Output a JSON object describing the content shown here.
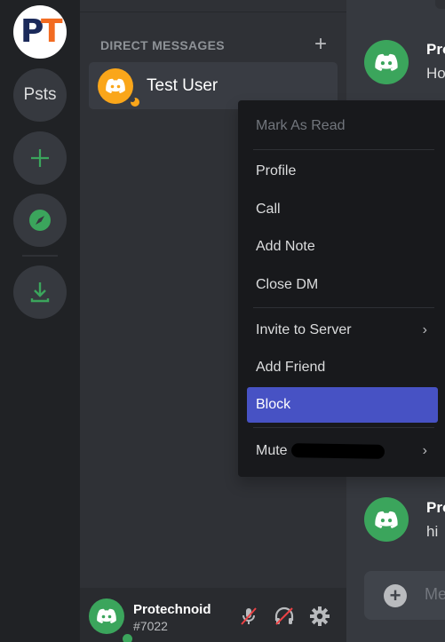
{
  "server_rail": {
    "logo_letters": [
      "P",
      "T"
    ],
    "items": [
      {
        "label": "Psts",
        "type": "server"
      },
      {
        "icon": "plus-icon",
        "label": "Add a Server"
      },
      {
        "icon": "compass-icon",
        "label": "Explore Public Servers"
      },
      {
        "icon": "download-icon",
        "label": "Download Apps"
      }
    ]
  },
  "sidebar": {
    "dm_header": "DIRECT MESSAGES",
    "dm_add_icon": "+",
    "dms": [
      {
        "name": "Test User",
        "avatar_color": "#faa61a",
        "status": "idle"
      }
    ]
  },
  "user_panel": {
    "username": "Protechnoid",
    "discriminator": "#7022",
    "status": "online",
    "mic_muted": true,
    "deafened": true
  },
  "chat": {
    "messages": [
      {
        "author": "Protechnoid",
        "text": "Ho"
      },
      {
        "author": "Protechnoid",
        "text": "hi"
      }
    ],
    "input_placeholder": "Message"
  },
  "context_menu": {
    "items": [
      {
        "label": "Mark As Read",
        "disabled": true
      },
      {
        "label": "Profile"
      },
      {
        "label": "Call"
      },
      {
        "label": "Add Note"
      },
      {
        "label": "Close DM"
      },
      {
        "label": "Invite to Server",
        "submenu": true
      },
      {
        "label": "Add Friend"
      },
      {
        "label": "Block",
        "highlighted": true
      },
      {
        "label": "Mute",
        "submenu": true,
        "redacted_suffix": true
      }
    ],
    "chevron": "›"
  },
  "colors": {
    "accent": "#4752c4",
    "online": "#3ba55c",
    "idle": "#faa61a",
    "muted_red": "#ed4245"
  }
}
